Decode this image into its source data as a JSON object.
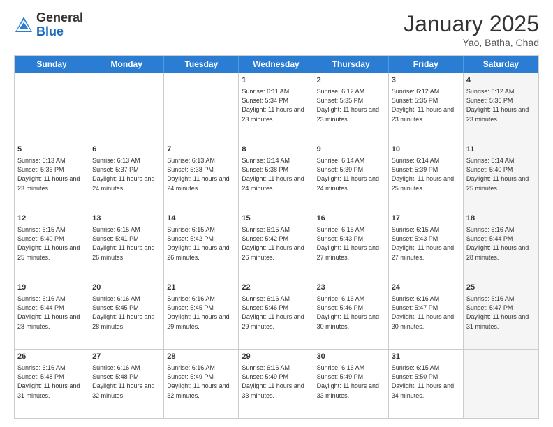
{
  "header": {
    "logo_general": "General",
    "logo_blue": "Blue",
    "month_title": "January 2025",
    "subtitle": "Yao, Batha, Chad"
  },
  "weekdays": [
    "Sunday",
    "Monday",
    "Tuesday",
    "Wednesday",
    "Thursday",
    "Friday",
    "Saturday"
  ],
  "rows": [
    [
      {
        "day": "",
        "info": "",
        "shaded": false
      },
      {
        "day": "",
        "info": "",
        "shaded": false
      },
      {
        "day": "",
        "info": "",
        "shaded": false
      },
      {
        "day": "1",
        "info": "Sunrise: 6:11 AM\nSunset: 5:34 PM\nDaylight: 11 hours\nand 23 minutes.",
        "shaded": false
      },
      {
        "day": "2",
        "info": "Sunrise: 6:12 AM\nSunset: 5:35 PM\nDaylight: 11 hours\nand 23 minutes.",
        "shaded": false
      },
      {
        "day": "3",
        "info": "Sunrise: 6:12 AM\nSunset: 5:35 PM\nDaylight: 11 hours\nand 23 minutes.",
        "shaded": false
      },
      {
        "day": "4",
        "info": "Sunrise: 6:12 AM\nSunset: 5:36 PM\nDaylight: 11 hours\nand 23 minutes.",
        "shaded": true
      }
    ],
    [
      {
        "day": "5",
        "info": "Sunrise: 6:13 AM\nSunset: 5:36 PM\nDaylight: 11 hours\nand 23 minutes.",
        "shaded": false
      },
      {
        "day": "6",
        "info": "Sunrise: 6:13 AM\nSunset: 5:37 PM\nDaylight: 11 hours\nand 24 minutes.",
        "shaded": false
      },
      {
        "day": "7",
        "info": "Sunrise: 6:13 AM\nSunset: 5:38 PM\nDaylight: 11 hours\nand 24 minutes.",
        "shaded": false
      },
      {
        "day": "8",
        "info": "Sunrise: 6:14 AM\nSunset: 5:38 PM\nDaylight: 11 hours\nand 24 minutes.",
        "shaded": false
      },
      {
        "day": "9",
        "info": "Sunrise: 6:14 AM\nSunset: 5:39 PM\nDaylight: 11 hours\nand 24 minutes.",
        "shaded": false
      },
      {
        "day": "10",
        "info": "Sunrise: 6:14 AM\nSunset: 5:39 PM\nDaylight: 11 hours\nand 25 minutes.",
        "shaded": false
      },
      {
        "day": "11",
        "info": "Sunrise: 6:14 AM\nSunset: 5:40 PM\nDaylight: 11 hours\nand 25 minutes.",
        "shaded": true
      }
    ],
    [
      {
        "day": "12",
        "info": "Sunrise: 6:15 AM\nSunset: 5:40 PM\nDaylight: 11 hours\nand 25 minutes.",
        "shaded": false
      },
      {
        "day": "13",
        "info": "Sunrise: 6:15 AM\nSunset: 5:41 PM\nDaylight: 11 hours\nand 26 minutes.",
        "shaded": false
      },
      {
        "day": "14",
        "info": "Sunrise: 6:15 AM\nSunset: 5:42 PM\nDaylight: 11 hours\nand 26 minutes.",
        "shaded": false
      },
      {
        "day": "15",
        "info": "Sunrise: 6:15 AM\nSunset: 5:42 PM\nDaylight: 11 hours\nand 26 minutes.",
        "shaded": false
      },
      {
        "day": "16",
        "info": "Sunrise: 6:15 AM\nSunset: 5:43 PM\nDaylight: 11 hours\nand 27 minutes.",
        "shaded": false
      },
      {
        "day": "17",
        "info": "Sunrise: 6:15 AM\nSunset: 5:43 PM\nDaylight: 11 hours\nand 27 minutes.",
        "shaded": false
      },
      {
        "day": "18",
        "info": "Sunrise: 6:16 AM\nSunset: 5:44 PM\nDaylight: 11 hours\nand 28 minutes.",
        "shaded": true
      }
    ],
    [
      {
        "day": "19",
        "info": "Sunrise: 6:16 AM\nSunset: 5:44 PM\nDaylight: 11 hours\nand 28 minutes.",
        "shaded": false
      },
      {
        "day": "20",
        "info": "Sunrise: 6:16 AM\nSunset: 5:45 PM\nDaylight: 11 hours\nand 28 minutes.",
        "shaded": false
      },
      {
        "day": "21",
        "info": "Sunrise: 6:16 AM\nSunset: 5:45 PM\nDaylight: 11 hours\nand 29 minutes.",
        "shaded": false
      },
      {
        "day": "22",
        "info": "Sunrise: 6:16 AM\nSunset: 5:46 PM\nDaylight: 11 hours\nand 29 minutes.",
        "shaded": false
      },
      {
        "day": "23",
        "info": "Sunrise: 6:16 AM\nSunset: 5:46 PM\nDaylight: 11 hours\nand 30 minutes.",
        "shaded": false
      },
      {
        "day": "24",
        "info": "Sunrise: 6:16 AM\nSunset: 5:47 PM\nDaylight: 11 hours\nand 30 minutes.",
        "shaded": false
      },
      {
        "day": "25",
        "info": "Sunrise: 6:16 AM\nSunset: 5:47 PM\nDaylight: 11 hours\nand 31 minutes.",
        "shaded": true
      }
    ],
    [
      {
        "day": "26",
        "info": "Sunrise: 6:16 AM\nSunset: 5:48 PM\nDaylight: 11 hours\nand 31 minutes.",
        "shaded": false
      },
      {
        "day": "27",
        "info": "Sunrise: 6:16 AM\nSunset: 5:48 PM\nDaylight: 11 hours\nand 32 minutes.",
        "shaded": false
      },
      {
        "day": "28",
        "info": "Sunrise: 6:16 AM\nSunset: 5:49 PM\nDaylight: 11 hours\nand 32 minutes.",
        "shaded": false
      },
      {
        "day": "29",
        "info": "Sunrise: 6:16 AM\nSunset: 5:49 PM\nDaylight: 11 hours\nand 33 minutes.",
        "shaded": false
      },
      {
        "day": "30",
        "info": "Sunrise: 6:16 AM\nSunset: 5:49 PM\nDaylight: 11 hours\nand 33 minutes.",
        "shaded": false
      },
      {
        "day": "31",
        "info": "Sunrise: 6:15 AM\nSunset: 5:50 PM\nDaylight: 11 hours\nand 34 minutes.",
        "shaded": false
      },
      {
        "day": "",
        "info": "",
        "shaded": true
      }
    ]
  ]
}
